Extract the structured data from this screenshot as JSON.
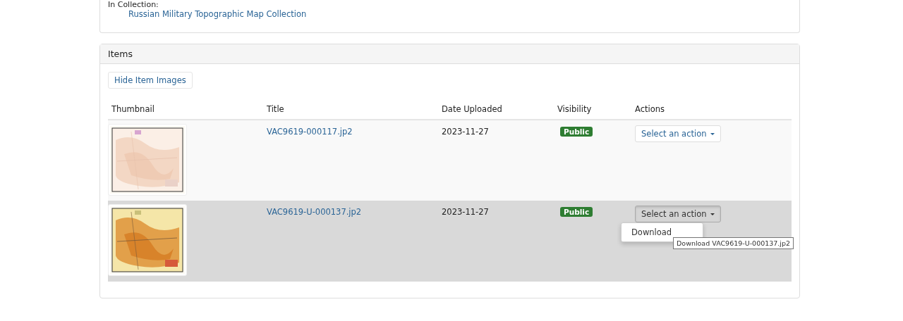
{
  "collection_panel": {
    "label": "In Collection:",
    "link": "Russian Military Topographic Map Collection"
  },
  "items_panel": {
    "title": "Items",
    "toggle_button": "Hide Item Images",
    "table": {
      "columns": [
        "Thumbnail",
        "Title",
        "Date Uploaded",
        "Visibility",
        "Actions"
      ],
      "rows": [
        {
          "thumbnail": {
            "kind": "picture"
          },
          "title": "VAC9619-000117.jp2",
          "date": "2023-11-27",
          "visibility": "Public",
          "action_button": "Select an action",
          "highlighted": false,
          "menu_open": false
        },
        {
          "thumbnail": {
            "kind": "picture"
          },
          "title": "VAC9619-U-000137.jp2",
          "date": "2023-11-27",
          "visibility": "Public",
          "action_button": "Select an action",
          "highlighted": true,
          "menu_open": true,
          "menu_items": [
            "Download"
          ],
          "tooltip": "Download VAC9619-U-000137.jp2"
        }
      ]
    }
  }
}
